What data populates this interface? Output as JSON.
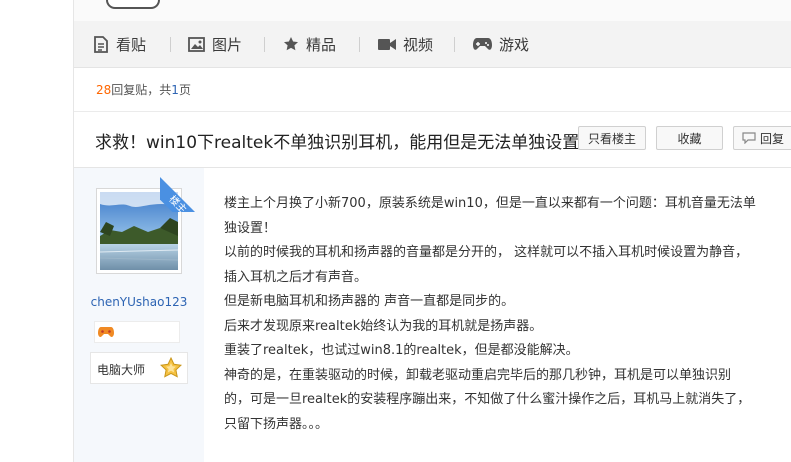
{
  "nav": {
    "tabs": [
      {
        "label": "看贴",
        "icon": "document-icon"
      },
      {
        "label": "图片",
        "icon": "image-icon"
      },
      {
        "label": "精品",
        "icon": "star-icon"
      },
      {
        "label": "视频",
        "icon": "video-icon"
      },
      {
        "label": "游戏",
        "icon": "gamepad-icon"
      }
    ]
  },
  "reply_info": {
    "count": "28",
    "count_suffix": "回复贴，共",
    "pages": "1",
    "pages_suffix": "页"
  },
  "thread": {
    "title": "求救！win10下realtek不单独识别耳机，能用但是无法单独设置",
    "buttons": {
      "only_op": "只看楼主",
      "favorite": "收藏",
      "reply": "回复"
    }
  },
  "post": {
    "ribbon_label": "楼主",
    "author": {
      "username": "chenYUshao123",
      "rank": "电脑大师"
    },
    "lines": [
      "楼主上个月换了小新700，原装系统是win10，但是一直以来都有一个问题：耳机音量无法单",
      "独设置！",
      "以前的时候我的耳机和扬声器的音量都是分开的， 这样就可以不插入耳机时候设置为静音，",
      "插入耳机之后才有声音。",
      "但是新电脑耳机和扬声器的 声音一直都是同步的。",
      "后来才发现原来realtek始终认为我的耳机就是扬声器。",
      "重装了realtek，也试过win8.1的realtek，但是都没能解决。",
      "神奇的是，在重装驱动的时候，卸载老驱动重启完毕后的那几秒钟，耳机是可以单独识别",
      "的，可是一旦realtek的安装程序蹦出来，不知做了什么蜜汁操作之后，耳机马上就消失了，",
      "只留下扬声器。。。"
    ]
  },
  "colors": {
    "accent_blue": "#2d64b3",
    "count_orange": "#f60",
    "ribbon_blue": "#4a90e2",
    "sidebar_bg": "#f5f8fc"
  }
}
